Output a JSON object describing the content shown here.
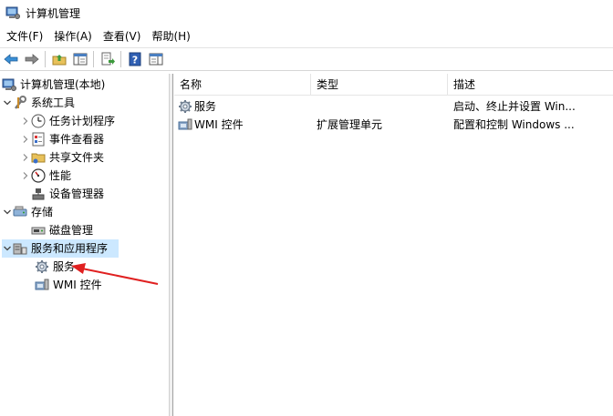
{
  "window": {
    "title": "计算机管理"
  },
  "menu": [
    {
      "label": "文件(F)"
    },
    {
      "label": "操作(A)"
    },
    {
      "label": "查看(V)"
    },
    {
      "label": "帮助(H)"
    }
  ],
  "toolbar": {
    "buttons": [
      "back-icon",
      "forward-icon",
      "up-folder-icon",
      "show-hide-tree-icon",
      "export-list-icon",
      "help-icon",
      "properties-pane-icon"
    ]
  },
  "tree": {
    "root": "计算机管理(本地)",
    "system_tools": "系统工具",
    "task_scheduler": "任务计划程序",
    "event_viewer": "事件查看器",
    "shared_folders": "共享文件夹",
    "performance": "性能",
    "device_manager": "设备管理器",
    "storage": "存储",
    "disk_management": "磁盘管理",
    "services_apps": "服务和应用程序",
    "services": "服务",
    "wmi": "WMI 控件"
  },
  "list": {
    "columns": [
      "名称",
      "类型",
      "描述"
    ],
    "rows": [
      {
        "name": "服务",
        "type": "",
        "desc": "启动、终止并设置 Win..."
      },
      {
        "name": "WMI 控件",
        "type": "扩展管理单元",
        "desc": "配置和控制 Windows ..."
      }
    ]
  },
  "colors": {
    "selection": "#cce8ff",
    "annotation_arrow": "#e02020"
  }
}
